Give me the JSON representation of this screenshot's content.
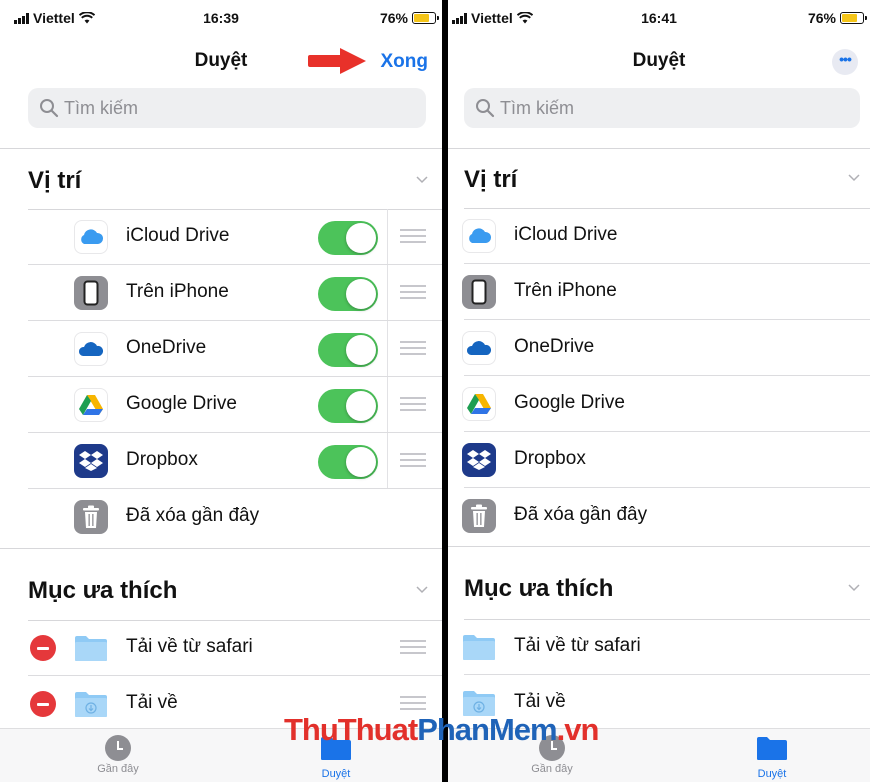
{
  "left_screen": {
    "status": {
      "carrier": "Viettel",
      "time": "16:39",
      "battery": "76%"
    },
    "nav": {
      "title": "Duyệt",
      "done_label": "Xong"
    },
    "search": {
      "placeholder": "Tìm kiếm"
    },
    "locations": {
      "title": "Vị trí",
      "items": [
        {
          "label": "iCloud Drive",
          "icon": "icloud-icon",
          "enabled": true
        },
        {
          "label": "Trên iPhone",
          "icon": "iphone-icon",
          "enabled": true
        },
        {
          "label": "OneDrive",
          "icon": "onedrive-icon",
          "enabled": true
        },
        {
          "label": "Google Drive",
          "icon": "google-drive-icon",
          "enabled": true
        },
        {
          "label": "Dropbox",
          "icon": "dropbox-icon",
          "enabled": true
        },
        {
          "label": "Đã xóa gần đây",
          "icon": "trash-icon"
        }
      ]
    },
    "favorites": {
      "title": "Mục ưa thích",
      "items": [
        {
          "label": "Tải về từ safari",
          "icon": "folder-icon"
        },
        {
          "label": "Tải về",
          "icon": "download-folder-icon"
        }
      ]
    },
    "tabbar": {
      "recents_label": "Gần đây",
      "browse_label": "Duyệt"
    }
  },
  "right_screen": {
    "status": {
      "carrier": "Viettel",
      "time": "16:41",
      "battery": "76%"
    },
    "nav": {
      "title": "Duyệt",
      "more_label": "•••"
    },
    "search": {
      "placeholder": "Tìm kiếm"
    },
    "locations": {
      "title": "Vị trí",
      "items": [
        {
          "label": "iCloud Drive",
          "icon": "icloud-icon"
        },
        {
          "label": "Trên iPhone",
          "icon": "iphone-icon"
        },
        {
          "label": "OneDrive",
          "icon": "onedrive-icon"
        },
        {
          "label": "Google Drive",
          "icon": "google-drive-icon"
        },
        {
          "label": "Dropbox",
          "icon": "dropbox-icon"
        },
        {
          "label": "Đã xóa gần đây",
          "icon": "trash-icon"
        }
      ]
    },
    "favorites": {
      "title": "Mục ưa thích",
      "items": [
        {
          "label": "Tải về từ safari",
          "icon": "folder-icon"
        },
        {
          "label": "Tải về",
          "icon": "download-folder-icon"
        }
      ]
    },
    "tabbar": {
      "recents_label": "Gần đây",
      "browse_label": "Duyệt"
    }
  },
  "watermark": {
    "part1": "ThuThuat",
    "part2": "PhanMem",
    "part3": ".vn"
  },
  "colors": {
    "accent": "#1a73e8",
    "toggle_on": "#4cc35a",
    "delete": "#e5383b",
    "arrow": "#e8312a"
  }
}
